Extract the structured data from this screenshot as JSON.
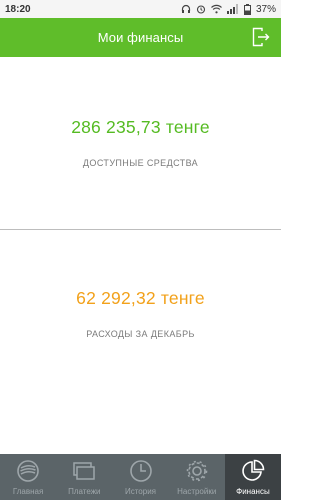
{
  "status_bar": {
    "time": "18:20",
    "battery": "37%",
    "icons": [
      "headphones-icon",
      "alarm-icon",
      "wifi-icon",
      "signal-icon",
      "battery-icon"
    ]
  },
  "header": {
    "title": "Мои финансы",
    "exit_icon": "exit-icon",
    "color": "#5fbd2a"
  },
  "available": {
    "amount": "286 235,73 тенге",
    "caption": "ДОСТУПНЫЕ СРЕДСТВА",
    "color": "#55bb22"
  },
  "expenses": {
    "amount": "62 292,32 тенге",
    "caption": "РАСХОДЫ ЗА ДЕКАБРЬ",
    "color": "#f2a11a"
  },
  "bottom_nav": {
    "items": [
      {
        "label": "Главная",
        "icon": "bank-logo-icon"
      },
      {
        "label": "Платежи",
        "icon": "payments-icon"
      },
      {
        "label": "История",
        "icon": "clock-icon"
      },
      {
        "label": "Настройки",
        "icon": "gear-icon"
      },
      {
        "label": "Финансы",
        "icon": "pie-chart-icon",
        "active": true
      }
    ]
  }
}
